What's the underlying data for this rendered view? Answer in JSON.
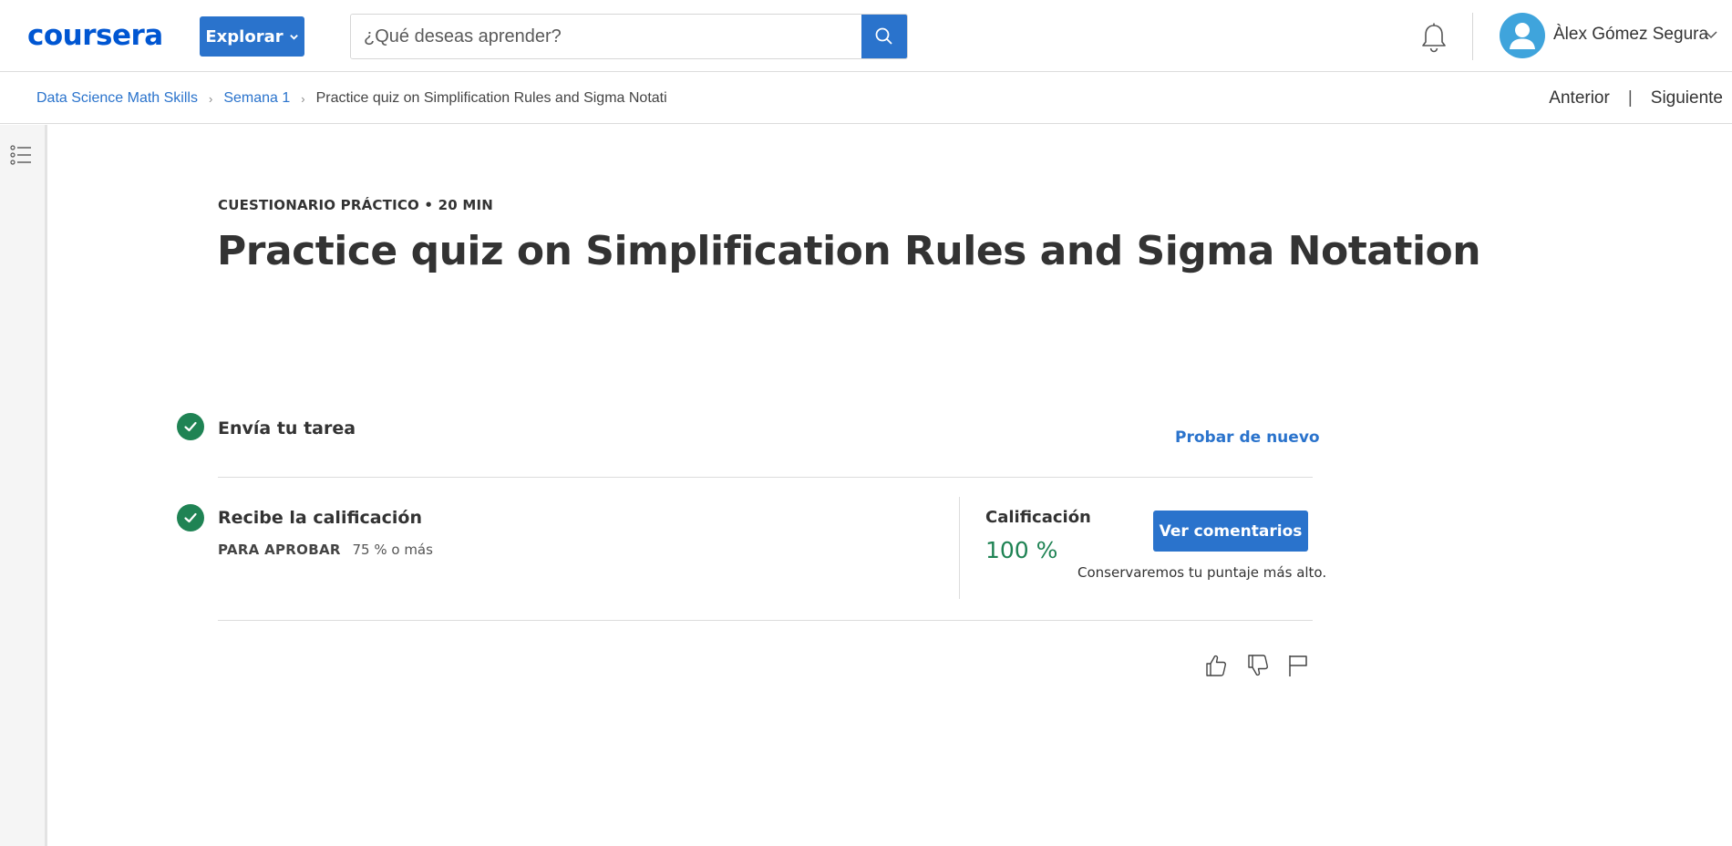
{
  "header": {
    "logo_text": "coursera",
    "explore_label": "Explorar",
    "search_placeholder": "¿Qué deseas aprender?",
    "user_name": "Àlex Gómez Segura",
    "icons": [
      "search-icon",
      "bell-icon",
      "user-avatar-icon",
      "chevron-down-icon"
    ]
  },
  "breadcrumb": {
    "items": [
      "Data Science Math Skills",
      "Semana 1"
    ],
    "current": "Practice quiz on Simplification Rules and Sigma Notati"
  },
  "nav": {
    "previous": "Anterior",
    "separator": "|",
    "next": "Siguiente"
  },
  "main": {
    "eyebrow": "CUESTIONARIO PRÁCTICO • 20 MIN",
    "title": "Practice quiz on Simplification Rules and Sigma Notation",
    "steps": [
      {
        "title": "Envía tu tarea",
        "action": "Probar de nuevo",
        "completed": true
      },
      {
        "title": "Recibe la calificación",
        "pass_label": "PARA APROBAR",
        "pass_value": "75 % o más",
        "completed": true
      }
    ],
    "grade": {
      "label": "Calificación",
      "value": "100 %",
      "button": "Ver comentarios",
      "note": "Conservaremos tu puntaje más alto."
    },
    "feedback_icons": [
      "thumbs-up-icon",
      "thumbs-down-icon",
      "flag-icon"
    ]
  },
  "colors": {
    "brand_blue": "#2a73cc",
    "logo_blue": "#0056d2",
    "success_green": "#1f8354",
    "text": "#333333"
  }
}
